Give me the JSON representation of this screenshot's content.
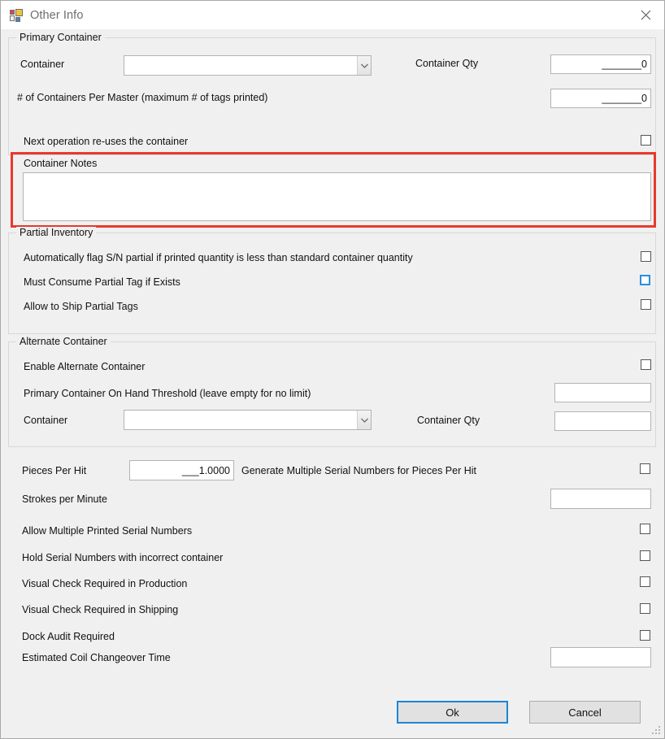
{
  "window": {
    "title": "Other Info",
    "icon": "forms-app-icon",
    "close_label": "✕"
  },
  "groups": {
    "primary_container": {
      "legend": "Primary Container",
      "container_label": "Container",
      "container_value": "",
      "container_qty_label": "Container Qty",
      "container_qty_value": "_______0",
      "per_master_label": "# of Containers Per Master (maximum # of tags printed)",
      "per_master_value": "_______0",
      "reuse_label": "Next operation re-uses the container",
      "reuse_checked": false
    },
    "container_notes": {
      "label": "Container Notes",
      "value": "",
      "highlight_color": "#e8392e"
    },
    "partial_inventory": {
      "legend": "Partial Inventory",
      "rows": [
        {
          "label": "Automatically flag S/N partial if printed quantity is less than standard container quantity",
          "checked": false,
          "state": "normal"
        },
        {
          "label": "Must Consume Partial Tag if Exists",
          "checked": false,
          "state": "hover"
        },
        {
          "label": "Allow to Ship Partial Tags",
          "checked": false,
          "state": "normal"
        }
      ]
    },
    "alternate_container": {
      "legend": "Alternate Container",
      "enable_label": "Enable Alternate Container",
      "enable_checked": false,
      "threshold_label": "Primary Container On Hand Threshold (leave empty for no limit)",
      "threshold_value": "",
      "container_label": "Container",
      "container_value": "",
      "container_qty_label": "Container Qty",
      "container_qty_value": ""
    }
  },
  "misc": {
    "pieces_per_hit_label": "Pieces Per Hit",
    "pieces_per_hit_value": "___1.0000",
    "generate_multiple_label": "Generate Multiple Serial Numbers for Pieces Per Hit",
    "generate_multiple_checked": false,
    "strokes_per_minute_label": "Strokes per Minute",
    "strokes_per_minute_value": "",
    "rows": [
      {
        "label": "Allow Multiple Printed Serial Numbers",
        "checked": false
      },
      {
        "label": "Hold Serial Numbers with incorrect container",
        "checked": false
      },
      {
        "label": "Visual Check Required in Production",
        "checked": false
      },
      {
        "label": "Visual Check Required in Shipping",
        "checked": false
      },
      {
        "label": "Dock Audit Required",
        "checked": false
      }
    ],
    "coil_changeover_label": "Estimated Coil Changeover Time",
    "coil_changeover_value": ""
  },
  "buttons": {
    "ok": "Ok",
    "cancel": "Cancel"
  },
  "colors": {
    "accent_blue": "#1e85d4",
    "highlight_red": "#e8392e",
    "window_bg": "#f0f0f0"
  }
}
